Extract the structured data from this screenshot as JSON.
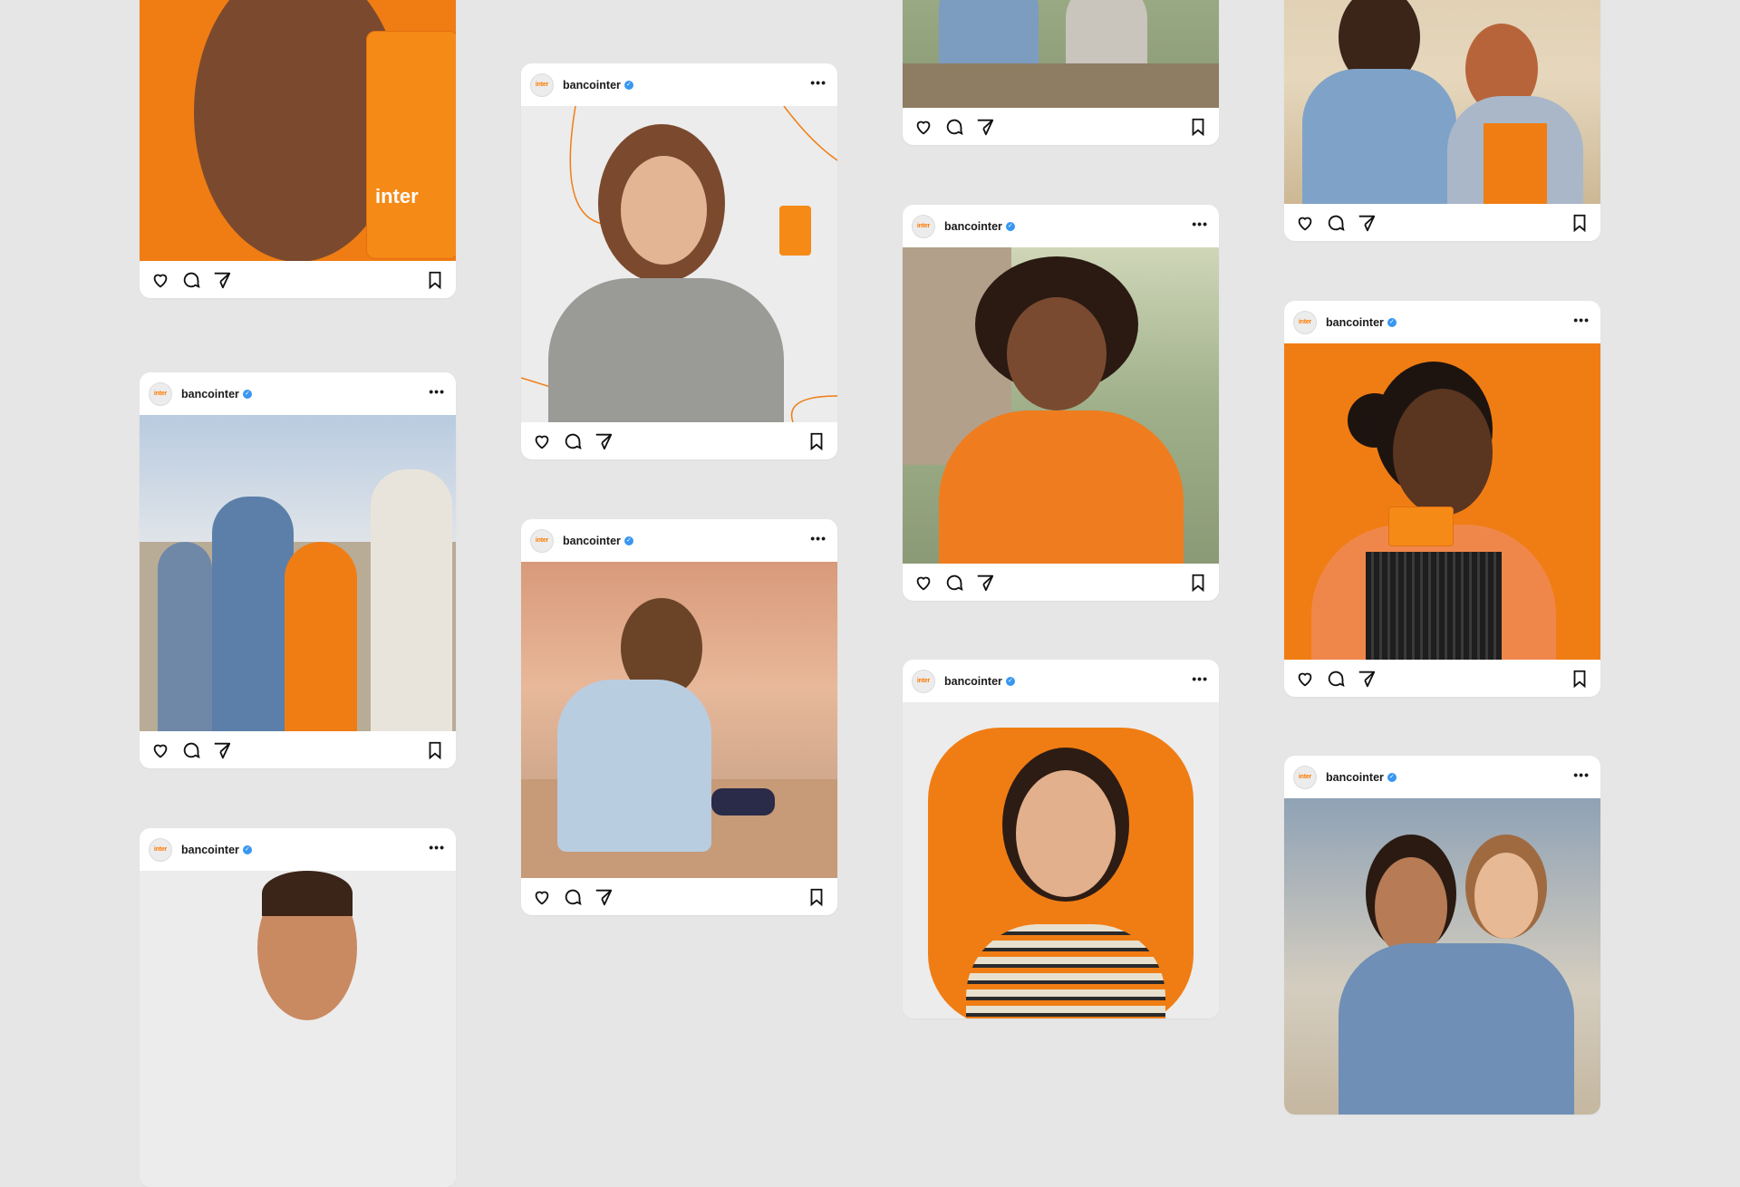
{
  "account": {
    "username": "bancointer",
    "avatar_text": "inter",
    "more_label": "•••"
  },
  "colors": {
    "brand_orange": "#ff7a00",
    "background": "#e6e6e6",
    "verified_blue": "#3897f0"
  },
  "posts": [
    {
      "image_alt": "woman holding orange inter card over eye",
      "card_text": "inter"
    },
    {
      "image_alt": "woman with bob haircut holding orange card"
    },
    {
      "image_alt": "group of friends outdoors"
    },
    {
      "image_alt": "man with afro hair in orange checked shirt"
    },
    {
      "image_alt": "two friends laughing"
    },
    {
      "image_alt": "woman with orange card on orange background"
    },
    {
      "image_alt": "girl sitting on steps with phone"
    },
    {
      "image_alt": "woman blowing a kiss holding card"
    },
    {
      "image_alt": "smiling man"
    },
    {
      "image_alt": "father and daughter"
    }
  ],
  "icons": [
    "heart-icon",
    "comment-icon",
    "share-icon",
    "bookmark-icon",
    "verified-icon"
  ]
}
